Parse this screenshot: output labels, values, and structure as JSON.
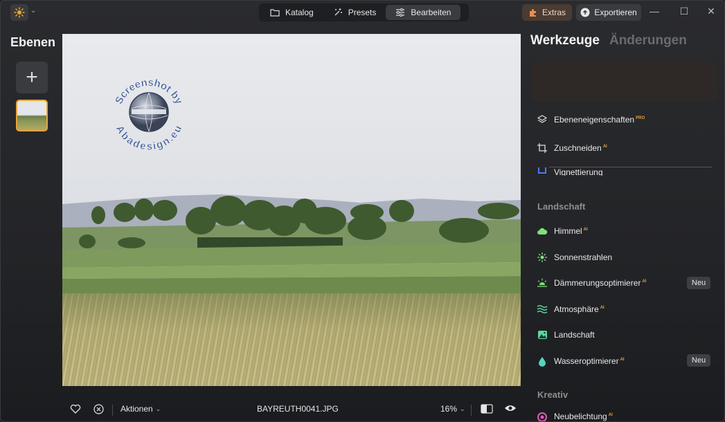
{
  "topnav": {
    "katalog": "Katalog",
    "presets": "Presets",
    "bearbeiten": "Bearbeiten"
  },
  "extras_label": "Extras",
  "export_label": "Exportieren",
  "layers": {
    "title": "Ebenen"
  },
  "canvas": {
    "watermark_text_top": "Screenshot by",
    "watermark_text_bottom": "Abadesign.eu"
  },
  "bottombar": {
    "actions_label": "Aktionen",
    "filename": "BAYREUTH0041.JPG",
    "zoom": "16%"
  },
  "panel": {
    "tab_tools": "Werkzeuge",
    "tab_changes": "Änderungen",
    "tools": [
      {
        "label": "Ebeneneigenschaften",
        "sup": "PRO",
        "icon": "layers-icon"
      },
      {
        "label": "Zuschneiden",
        "sup": "AI",
        "icon": "crop-icon"
      },
      {
        "label": "Vignettierung",
        "sup": "",
        "icon": "vignette-icon"
      }
    ],
    "section_landscape": "Landschaft",
    "landscape": [
      {
        "label": "Himmel",
        "sup": "AI",
        "icon": "cloud-icon",
        "color": "#7ee07a"
      },
      {
        "label": "Sonnenstrahlen",
        "sup": "",
        "icon": "sun-rays-icon",
        "color": "#7ee07a"
      },
      {
        "label": "Dämmerungsoptimierer",
        "sup": "AI",
        "icon": "sunset-icon",
        "color": "#7ee07a",
        "badge": "Neu"
      },
      {
        "label": "Atmosphäre",
        "sup": "AI",
        "icon": "waves-icon",
        "color": "#5fd6a0"
      },
      {
        "label": "Landschaft",
        "sup": "",
        "icon": "landscape-icon",
        "color": "#5fd6a0"
      },
      {
        "label": "Wasseroptimierer",
        "sup": "AI",
        "icon": "water-drop-icon",
        "color": "#4fd6c0",
        "badge": "Neu"
      }
    ],
    "section_creative": "Kreativ",
    "creative": [
      {
        "label": "Neubelichtung",
        "sup": "AI",
        "icon": "relight-icon",
        "color": "#e05ab8"
      }
    ]
  },
  "colors": {
    "accent": "#e8a53a",
    "extras_bg": "#4a3b33"
  }
}
